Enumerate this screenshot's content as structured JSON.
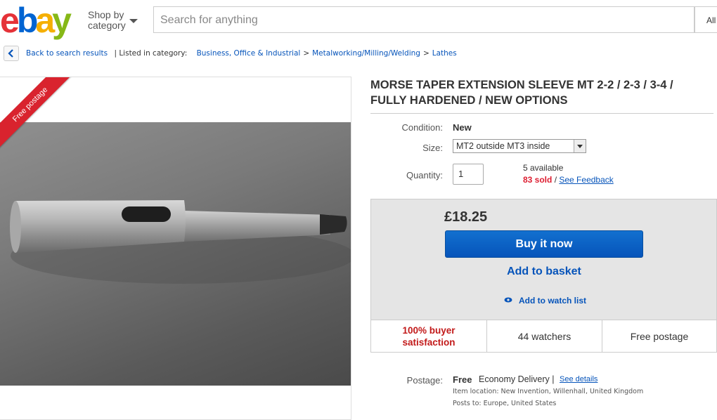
{
  "header": {
    "logo": [
      "e",
      "b",
      "a",
      "y"
    ],
    "logo_colors": [
      "#e53238",
      "#0064d2",
      "#f5af02",
      "#86b817"
    ],
    "shop_by_line1": "Shop by",
    "shop_by_line2": "category",
    "search_placeholder": "Search for anything",
    "search_category": "All"
  },
  "breadcrumb": {
    "back_label": "Back to search results",
    "listed_in": "| Listed in category:",
    "items": [
      "Business, Office & Industrial",
      "Metalworking/Milling/Welding",
      "Lathes"
    ],
    "separator": ">"
  },
  "image": {
    "ribbon": "Free postage"
  },
  "item": {
    "title": "MORSE TAPER EXTENSION SLEEVE MT 2-2 / 2-3 / 3-4 / FULLY HARDENED / NEW OPTIONS",
    "condition_label": "Condition:",
    "condition_value": "New",
    "size_label": "Size:",
    "size_value": "MT2 outside MT3 inside",
    "quantity_label": "Quantity:",
    "quantity_value": "1",
    "available": "5 available",
    "sold": "83 sold",
    "sold_sep": " / ",
    "feedback_link": "See Feedback"
  },
  "buy": {
    "price": "£18.25",
    "buy_now": "Buy it now",
    "add_basket": "Add to basket",
    "watch_list": "Add to watch list"
  },
  "stats": {
    "satisfaction_1": "100% buyer",
    "satisfaction_2": "satisfaction",
    "watchers": "44 watchers",
    "postage": "Free postage"
  },
  "postage": {
    "label": "Postage:",
    "free": "Free",
    "service": "Economy Delivery |",
    "details_link": "See details",
    "location": "Item location:  New Invention, Willenhall, United Kingdom",
    "posts_to": "Posts to:  Europe, United States"
  },
  "colors": {
    "link": "#0654ba",
    "buy_button": "#0654ba",
    "ribbon": "#d9232e",
    "sold": "#dd1e31"
  }
}
